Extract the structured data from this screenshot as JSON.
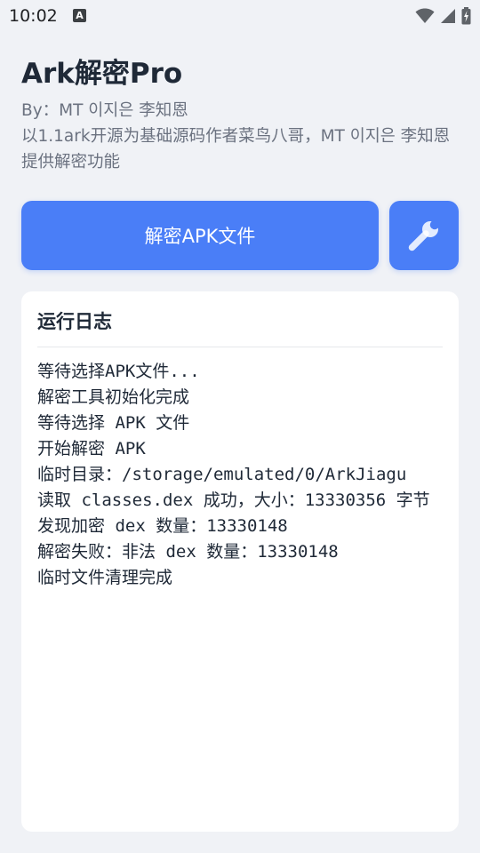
{
  "status_bar": {
    "time": "10:02",
    "notification_icon": "A"
  },
  "header": {
    "title": "Ark解密Pro",
    "byline": "By：MT 이지은 李知恩",
    "description": "以1.1ark开源为基础源码作者菜鸟八哥，MT 이지은 李知恩提供解密功能"
  },
  "actions": {
    "decrypt_label": "解密APK文件",
    "tools_icon": "wrench-icon"
  },
  "log": {
    "title": "运行日志",
    "lines": [
      "等待选择APK文件...",
      "解密工具初始化完成",
      "等待选择 APK 文件",
      "开始解密 APK",
      "临时目录：/storage/emulated/0/ArkJiagu",
      "读取 classes.dex 成功，大小：13330356 字节",
      "发现加密 dex 数量：13330148",
      "解密失败：非法 dex 数量：13330148",
      "临时文件清理完成"
    ]
  },
  "colors": {
    "accent": "#4a7ef7",
    "background": "#f0f2f6",
    "card": "#ffffff"
  }
}
